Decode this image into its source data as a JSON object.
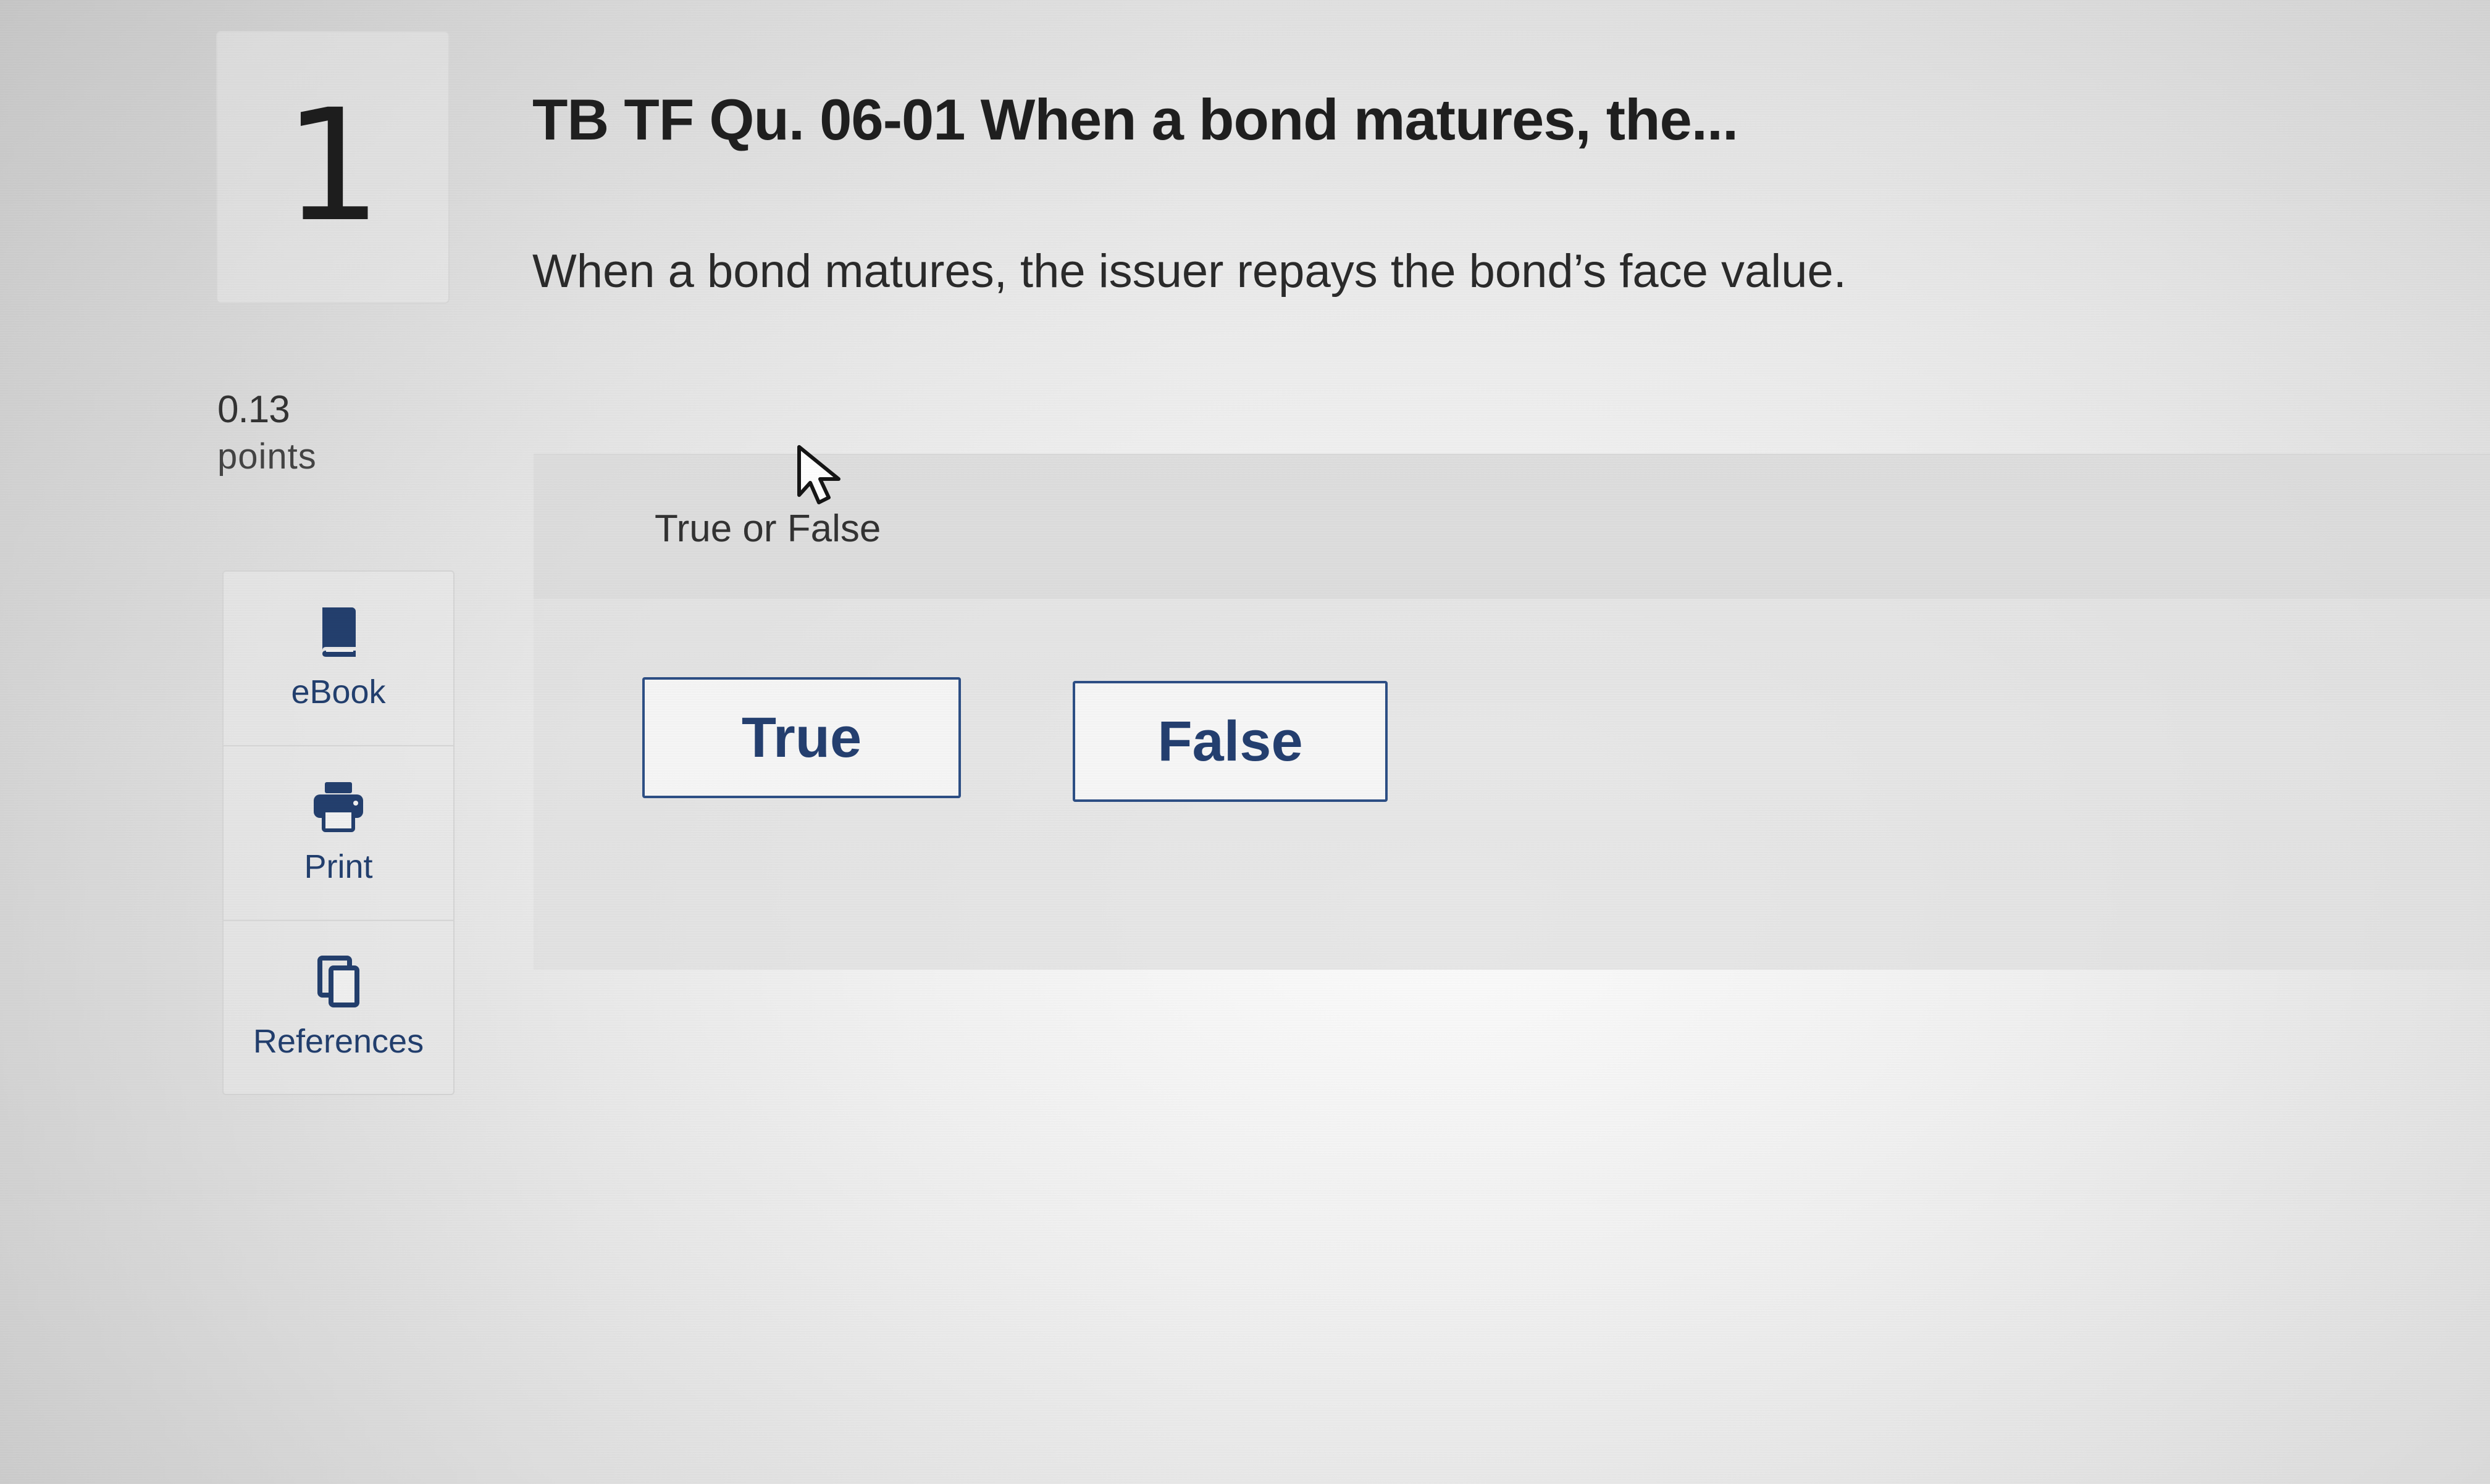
{
  "question": {
    "number": "1",
    "title": "TB TF Qu. 06-01 When a bond matures, the...",
    "text": "When a bond matures, the issuer repays the bond’s face value.",
    "points_value": "0.13",
    "points_label": "points"
  },
  "tools": {
    "ebook_label": "eBook",
    "print_label": "Print",
    "references_label": "References"
  },
  "answer": {
    "type_label": "True or False",
    "options": [
      {
        "label": "True"
      },
      {
        "label": "False"
      }
    ]
  },
  "theme": {
    "link_color": "#223f6f",
    "button_border": "#2d4f86"
  },
  "icons": {
    "ebook": "book-icon",
    "print": "printer-icon",
    "references": "copy-icon",
    "cursor": "mouse-pointer-icon"
  }
}
